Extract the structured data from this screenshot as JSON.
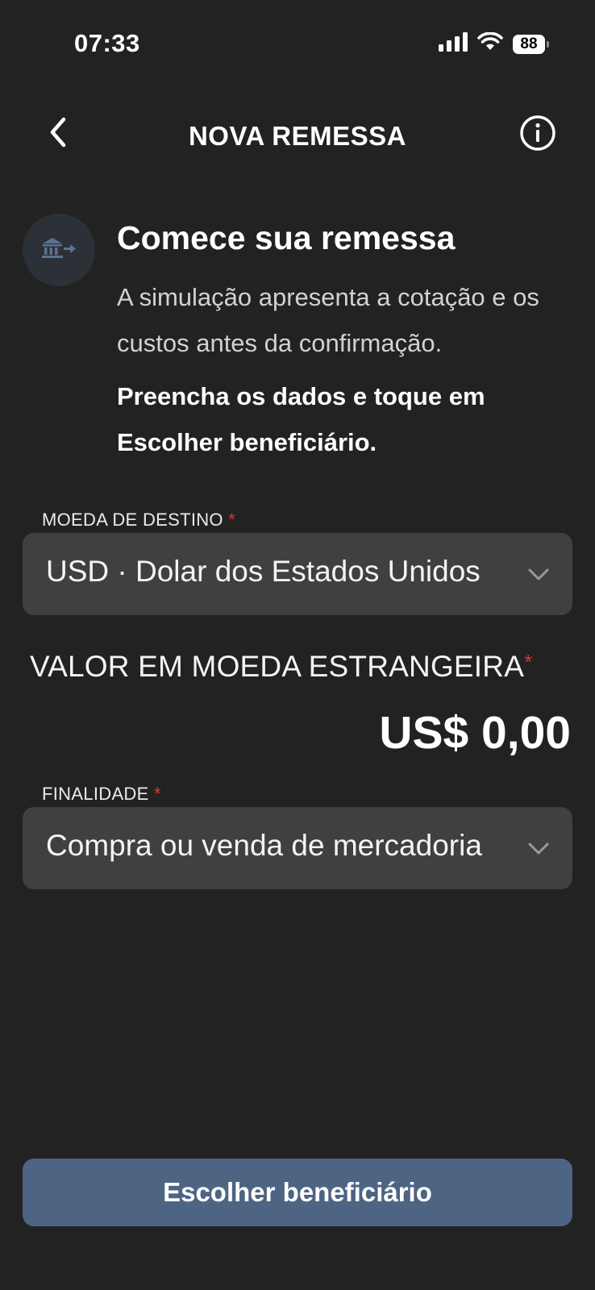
{
  "status_bar": {
    "time": "07:33",
    "battery": "88",
    "icons": [
      "cellular-signal-icon",
      "wifi-icon",
      "battery-icon"
    ]
  },
  "nav": {
    "title": "NOVA REMESSA",
    "back_icon": "chevron-left-icon",
    "info_icon": "info-circle-icon"
  },
  "intro": {
    "icon": "bank-transfer-icon",
    "title": "Comece sua remessa",
    "description": "A simulação apresenta a cotação e os custos antes da confirmação.",
    "cta_text": "Preencha os dados e toque em Escolher beneficiário."
  },
  "currency_field": {
    "label": "MOEDA DE DESTINO",
    "required_mark": "*",
    "value": "USD · Dolar dos Estados Unidos"
  },
  "amount_field": {
    "label": "VALOR EM MOEDA ESTRANGEIRA",
    "required_mark": "*",
    "value": "US$ 0,00"
  },
  "purpose_field": {
    "label": "FINALIDADE",
    "required_mark": "*",
    "value": "Compra ou venda de mercadoria"
  },
  "primary_button": {
    "label": "Escolher beneficiário"
  },
  "colors": {
    "background": "#222222",
    "field_background": "#404040",
    "button_background": "#4e6483",
    "required": "#e0333a",
    "icon_accent": "#5b7293"
  }
}
